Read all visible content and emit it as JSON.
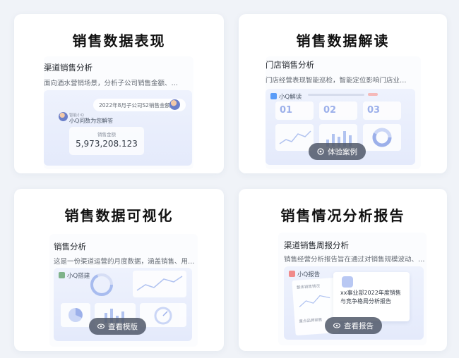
{
  "cards": [
    {
      "title": "销售数据表现",
      "subtitle": "渠道销售分析",
      "description": "面向酒水营销场景，分析子公司销售金额、…",
      "preview": {
        "query_bubble": "2022年8月子公司S2销售金额",
        "assistant_name": "智能小Q",
        "assistant_reply": "小Q问数为您解答",
        "metric_label": "销售金额",
        "metric_value": "5,973,208.123"
      }
    },
    {
      "title": "销售数据解读",
      "subtitle": "门店销售分析",
      "description": "门店经营表现智能巡检，智能定位影响门店业…",
      "preview": {
        "tag": "小Q解读",
        "tiles": [
          "01",
          "02",
          "03"
        ],
        "button": "体验案例"
      }
    },
    {
      "title": "销售数据可视化",
      "subtitle": "销售分析",
      "description": "这是一份渠道运营的月度数据，涵盖销售、用…",
      "preview": {
        "tag": "小Q搭建",
        "button": "查看模版"
      }
    },
    {
      "title": "销售情况分析报告",
      "subtitle": "渠道销售周报分析",
      "description": "销售经营分析报告旨在通过对销售规模波动、…",
      "preview": {
        "tag": "小Q报告",
        "doc_label_1": "整体销售情况",
        "doc_label_2": "重点品牌销售",
        "report_title": "xx事业部2022年度销售与竞争格局分析报告",
        "button": "查看报告"
      }
    }
  ],
  "colors": {
    "accent": "#3370ff",
    "tile_number": "#8fa6e8",
    "button_bg": "#505868"
  },
  "icons": {
    "button_icon": "eye-icon",
    "play_icon": "play-circle-icon"
  }
}
